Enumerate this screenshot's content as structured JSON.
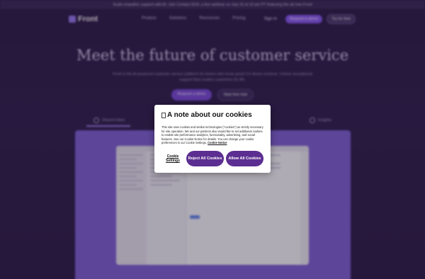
{
  "banner": {
    "text": "Scale empathic support with AI: Join Contact IDOL a live webinar on July 15 at 10 am PT featuring the all new Front"
  },
  "nav": {
    "brand": "Front",
    "links": [
      "Product",
      "Solutions",
      "Resources",
      "Pricing"
    ],
    "signin": "Sign in",
    "request_demo": "Request a demo",
    "try_free": "Try for free"
  },
  "hero": {
    "title": "Meet the future of customer service",
    "subtitle": "Front is the AI-powered customer service platform for teams who know great CX drives revenue. Unlock exceptional support that creates customers for life.",
    "cta_primary": "Request a demo",
    "cta_secondary": "Start free trial"
  },
  "tabs": [
    "Shared inbox",
    "Insights"
  ],
  "cookie_dialog": {
    "title": "A note about our cookies",
    "body": "This site uses cookies and similar technologies (\"cookies\") as strictly necessary for site operation. We and our partners also would like to set additional cookies to enable site performance analytics, functionality, advertising, and social features. See our Cookie Notice for details. You can change your cookie preferences in our Cookie Settings.",
    "notice_link": "Cookie Notice",
    "settings_label": "Cookie Settings",
    "reject_label": "Reject All Cookies",
    "allow_label": "Allow All Cookies"
  },
  "colors": {
    "page_bg": "#2c1c46",
    "button_purple": "#5c2e91",
    "showcase": "#8163d6"
  }
}
